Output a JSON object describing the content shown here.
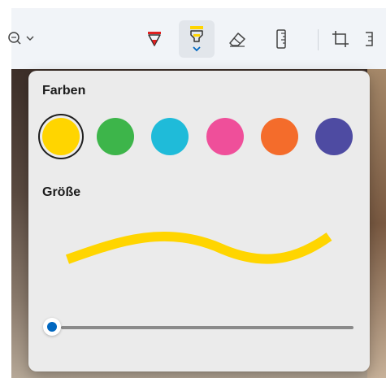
{
  "toolbar": {
    "tools": [
      {
        "name": "view-options",
        "icon": "magnifier-dropdown-icon"
      },
      {
        "name": "ballpoint-pen",
        "icon": "ballpoint-pen-icon",
        "color": "#e02020"
      },
      {
        "name": "highlighter",
        "icon": "highlighter-icon",
        "color": "#ffd500",
        "active": true
      },
      {
        "name": "eraser",
        "icon": "eraser-icon"
      },
      {
        "name": "ruler",
        "icon": "ruler-icon"
      },
      {
        "name": "crop",
        "icon": "crop-icon"
      }
    ]
  },
  "flyout": {
    "colors_title": "Farben",
    "size_title": "Größe",
    "colors": [
      {
        "name": "yellow",
        "hex": "#ffd500",
        "selected": true
      },
      {
        "name": "green",
        "hex": "#3db54a"
      },
      {
        "name": "cyan",
        "hex": "#1fbbd9"
      },
      {
        "name": "pink",
        "hex": "#ef4f9a"
      },
      {
        "name": "orange",
        "hex": "#f46c2b"
      },
      {
        "name": "indigo",
        "hex": "#4e4ba2"
      }
    ],
    "stroke_color": "#ffd500",
    "size_slider": {
      "value": 0,
      "accent": "#0067c0"
    }
  }
}
